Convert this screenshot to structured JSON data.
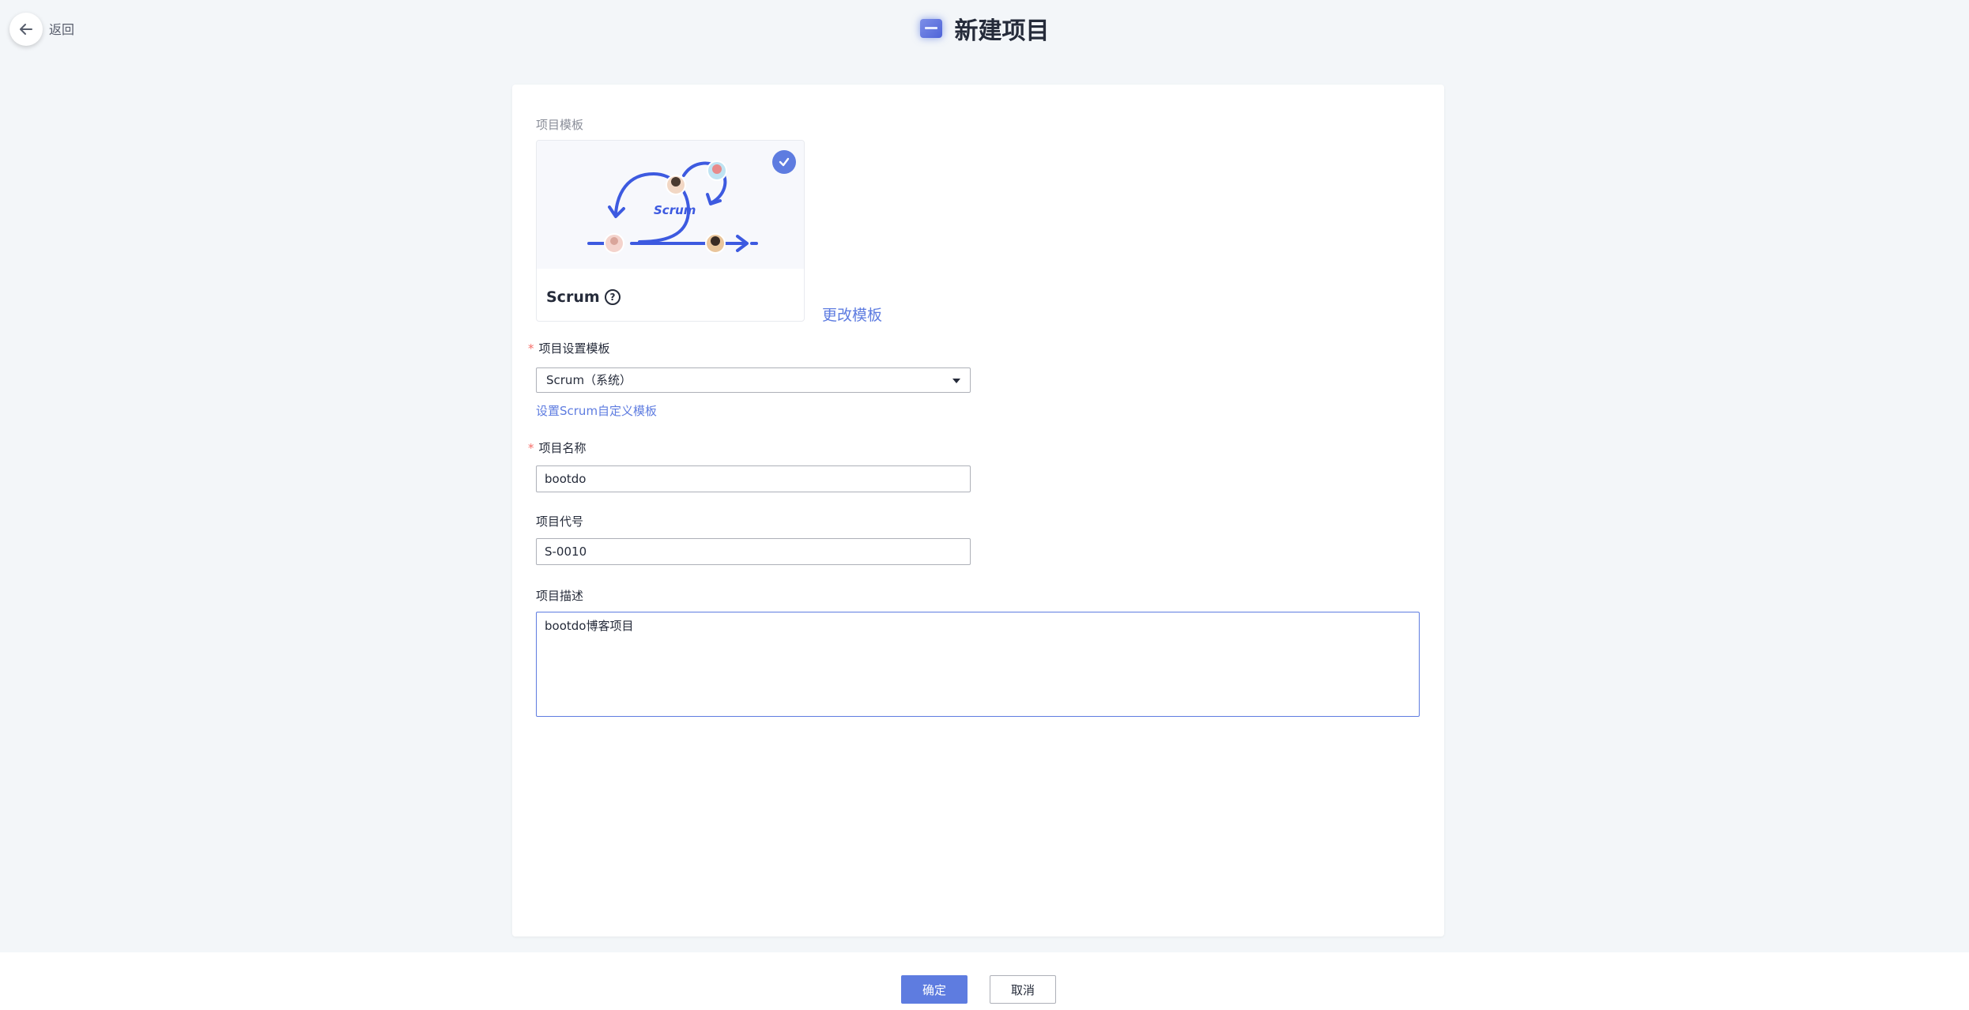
{
  "header": {
    "back_label": "返回",
    "title": "新建项目"
  },
  "form": {
    "template_section_label": "项目模板",
    "template": {
      "name": "Scrum",
      "image_text": "Scrum",
      "change_link": "更改模板"
    },
    "settings_template": {
      "label": "项目设置模板",
      "selected": "Scrum（系统）",
      "custom_link": "设置Scrum自定义模板"
    },
    "project_name": {
      "label": "项目名称",
      "value": "bootdo"
    },
    "project_code": {
      "label": "项目代号",
      "value": "S-0010"
    },
    "project_desc": {
      "label": "项目描述",
      "value": "bootdo博客项目"
    }
  },
  "footer": {
    "confirm_label": "确定",
    "cancel_label": "取消"
  },
  "colors": {
    "accent": "#5e7ce0",
    "required": "#f66f6a",
    "background": "#f3f6f9"
  }
}
